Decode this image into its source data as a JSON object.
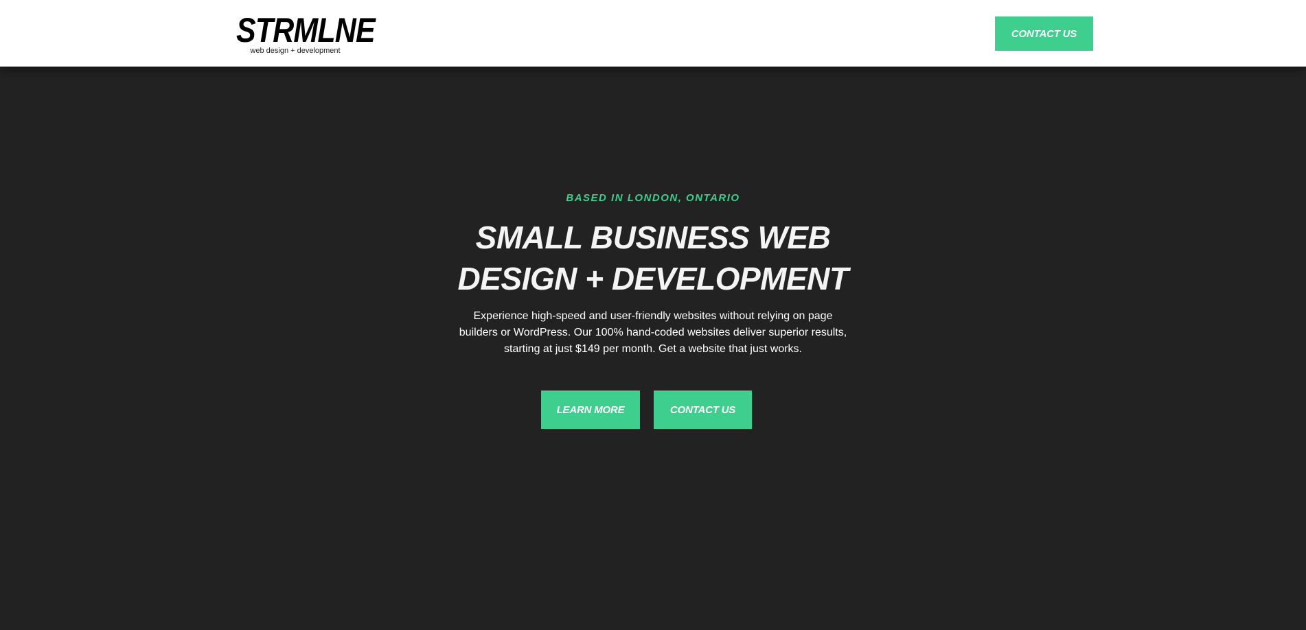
{
  "header": {
    "logo_name": "STRMLNE",
    "logo_tagline": "web design + development",
    "contact_label": "CONTACT US"
  },
  "hero": {
    "eyebrow": "BASED IN LONDON, ONTARIO",
    "headline": "SMALL BUSINESS WEB DESIGN + DEVELOPMENT",
    "subtext": "Experience high-speed and user-friendly websites without relying on page builders or WordPress. Our 100% hand-coded websites deliver superior results, starting at just $149 per month. Get a website that just works.",
    "learn_more_label": "LEARN MORE",
    "contact_label": "CONTACT US"
  },
  "colors": {
    "accent": "#3ecf8e",
    "background": "#222222",
    "header_background": "#ffffff"
  }
}
